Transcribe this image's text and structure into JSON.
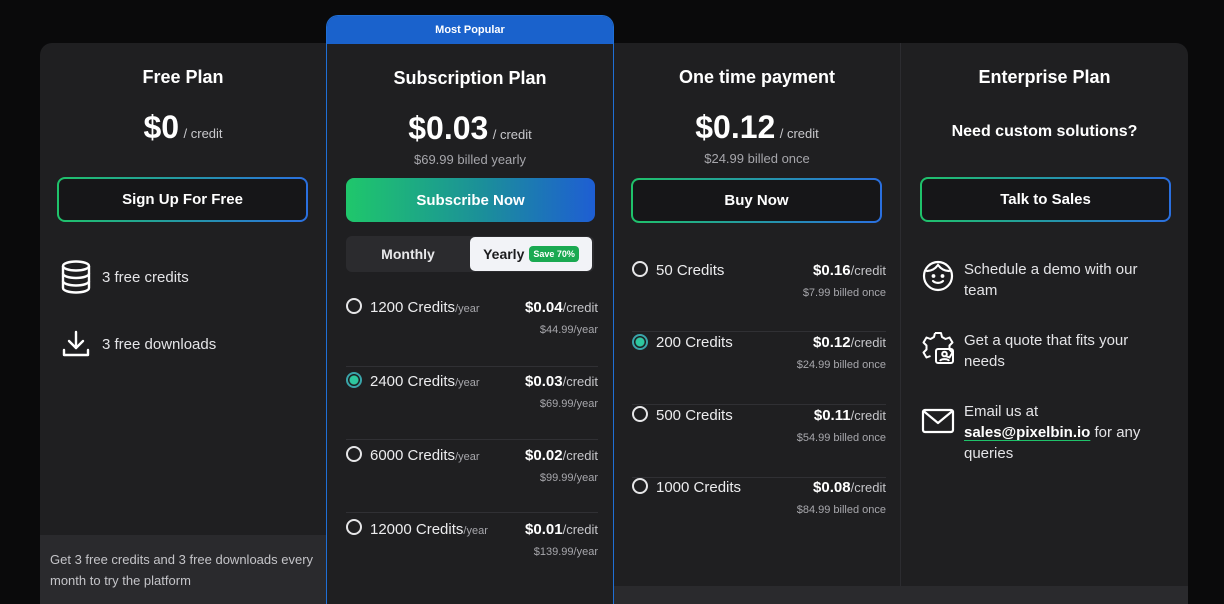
{
  "free": {
    "title": "Free Plan",
    "price": "$0",
    "unit": "/ credit",
    "button": "Sign Up For Free",
    "features": [
      "3 free credits",
      "3 free downloads"
    ],
    "footer": "Get 3 free credits and 3 free downloads every month to try the platform"
  },
  "subscription": {
    "badge": "Most Popular",
    "title": "Subscription Plan",
    "price": "$0.03",
    "unit": "/ credit",
    "billed": "$69.99 billed yearly",
    "button": "Subscribe Now",
    "toggle": {
      "monthly": "Monthly",
      "yearly": "Yearly",
      "save": "Save 70%",
      "selected": "Yearly"
    },
    "options": [
      {
        "credits": "1200 Credits",
        "period": "/year",
        "price": "$0.04",
        "per": "/credit",
        "billed": "$44.99/year",
        "selected": false
      },
      {
        "credits": "2400 Credits",
        "period": "/year",
        "price": "$0.03",
        "per": "/credit",
        "billed": "$69.99/year",
        "selected": true
      },
      {
        "credits": "6000 Credits",
        "period": "/year",
        "price": "$0.02",
        "per": "/credit",
        "billed": "$99.99/year",
        "selected": false
      },
      {
        "credits": "12000 Credits",
        "period": "/year",
        "price": "$0.01",
        "per": "/credit",
        "billed": "$139.99/year",
        "selected": false
      }
    ]
  },
  "onetime": {
    "title": "One time payment",
    "price": "$0.12",
    "unit": "/ credit",
    "billed": "$24.99 billed once",
    "button": "Buy Now",
    "options": [
      {
        "credits": "50 Credits",
        "price": "$0.16",
        "per": "/credit",
        "billed": "$7.99 billed once",
        "selected": false
      },
      {
        "credits": "200 Credits",
        "price": "$0.12",
        "per": "/credit",
        "billed": "$24.99 billed once",
        "selected": true
      },
      {
        "credits": "500 Credits",
        "price": "$0.11",
        "per": "/credit",
        "billed": "$54.99 billed once",
        "selected": false
      },
      {
        "credits": "1000 Credits",
        "price": "$0.08",
        "per": "/credit",
        "billed": "$84.99 billed once",
        "selected": false
      }
    ]
  },
  "enterprise": {
    "title": "Enterprise Plan",
    "subtitle": "Need custom solutions?",
    "button": "Talk to Sales",
    "items": [
      {
        "icon": "smiley-icon",
        "text": "Schedule a demo with our team"
      },
      {
        "icon": "gear-user-icon",
        "text": "Get a quote that fits your needs"
      },
      {
        "icon": "mail-icon",
        "text_before": "Email us at",
        "email": "sales@pixelbin.io",
        "text_after": "for any queries"
      }
    ]
  },
  "colors": {
    "accent_green": "#1fc26a",
    "accent_blue": "#1e5ed3",
    "badge": "#1a62cc",
    "panel": "#1f1f21"
  }
}
